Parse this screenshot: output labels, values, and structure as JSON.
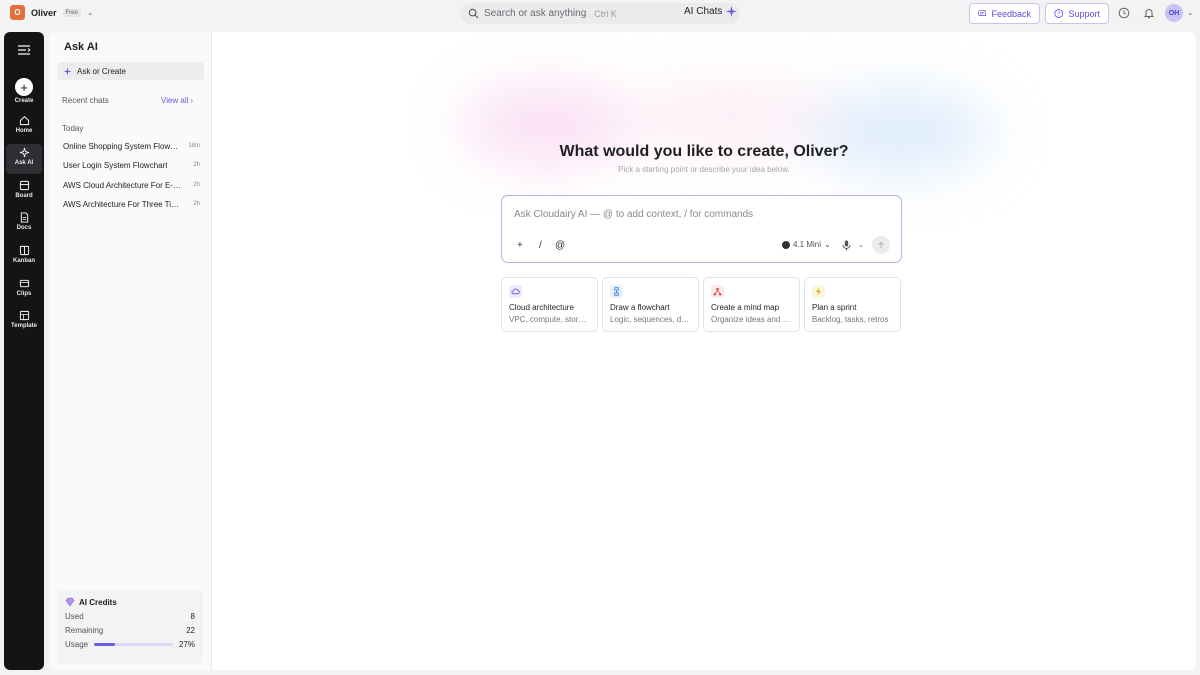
{
  "workspace": {
    "initial": "O",
    "name": "Oliver",
    "plan": "Free"
  },
  "search": {
    "placeholder": "Search or ask anything",
    "shortcut": "Ctrl K",
    "ai_chats_label": "AI Chats"
  },
  "header": {
    "feedback_label": "Feedback",
    "support_label": "Support",
    "user_initials": "OH"
  },
  "rail": {
    "items": [
      {
        "label": "Create",
        "icon": "plus-icon"
      },
      {
        "label": "Home",
        "icon": "home-icon"
      },
      {
        "label": "Ask AI",
        "icon": "sparkle-icon"
      },
      {
        "label": "Board",
        "icon": "board-icon"
      },
      {
        "label": "Docs",
        "icon": "docs-icon"
      },
      {
        "label": "Kanban",
        "icon": "kanban-icon"
      },
      {
        "label": "Clips",
        "icon": "clips-icon"
      },
      {
        "label": "Template",
        "icon": "template-icon"
      }
    ]
  },
  "panel": {
    "title": "Ask AI",
    "ask_create_label": "Ask or Create",
    "recent_label": "Recent chats",
    "view_all_label": "View all",
    "today_label": "Today",
    "chats": [
      {
        "title": "Online Shopping System Flowchart",
        "time": "18m"
      },
      {
        "title": "User Login System Flowchart",
        "time": "2h"
      },
      {
        "title": "AWS Cloud Architecture For E-commerce",
        "time": "2h"
      },
      {
        "title": "AWS Architecture For Three Tier App",
        "time": "2h"
      }
    ],
    "credits": {
      "title": "AI Credits",
      "used_label": "Used",
      "used_value": "8",
      "remaining_label": "Remaining",
      "remaining_value": "22",
      "usage_label": "Usage",
      "usage_value": "27%",
      "usage_fraction": 0.27
    }
  },
  "main": {
    "headline": "What would you like to create, Oliver?",
    "subline": "Pick a starting point or describe your idea below.",
    "prompt_placeholder": "Ask Cloudairy AI — @ to add context, / for commands",
    "tools": [
      "+",
      "/",
      "@"
    ],
    "model_label": "4.1 Mini",
    "cards": [
      {
        "title": "Cloud architecture",
        "desc": "VPC, compute, storage, networking",
        "icon": "cloud-icon",
        "color": "#7c5cf0",
        "bg": "#efe9fd"
      },
      {
        "title": "Draw a flowchart",
        "desc": "Logic, sequences, decisions",
        "icon": "flowchart-icon",
        "color": "#2f7fd8",
        "bg": "#e6f0fb"
      },
      {
        "title": "Create a mind map",
        "desc": "Organize ideas and links",
        "icon": "mindmap-icon",
        "color": "#d94b4b",
        "bg": "#fdebeb"
      },
      {
        "title": "Plan a sprint",
        "desc": "Backlog, tasks, retros",
        "icon": "lightning-icon",
        "color": "#e3b21c",
        "bg": "#fdf6df"
      }
    ]
  }
}
